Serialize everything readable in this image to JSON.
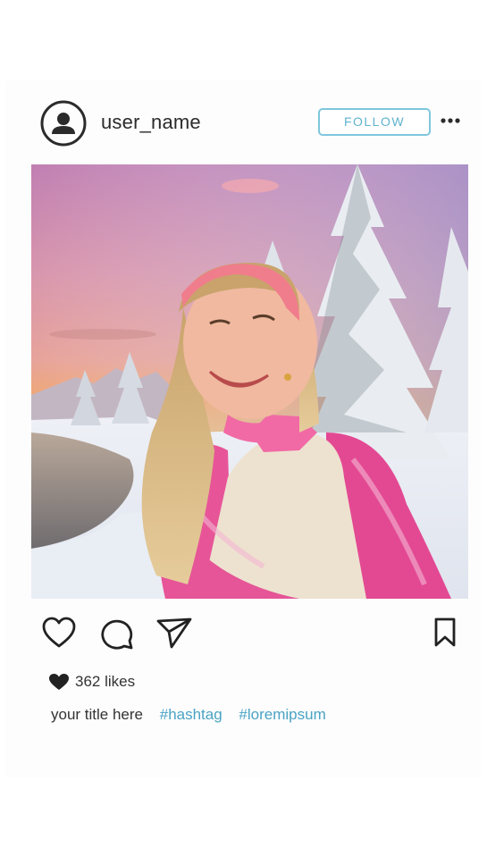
{
  "post": {
    "username": "user_name",
    "follow_label": "FOLLOW",
    "likes": "362 likes",
    "caption_title": "your title here",
    "hashtags": [
      "#hashtag",
      "#loremipsum"
    ]
  },
  "icons": {
    "avatar": "user-avatar-icon",
    "more": "more-options-icon",
    "like": "heart-icon",
    "comment": "comment-icon",
    "share": "send-icon",
    "save": "bookmark-icon"
  },
  "colors": {
    "accent": "#5eb3cd",
    "hashtag": "#4aa3c4",
    "follow_border": "#7fc6dc"
  }
}
